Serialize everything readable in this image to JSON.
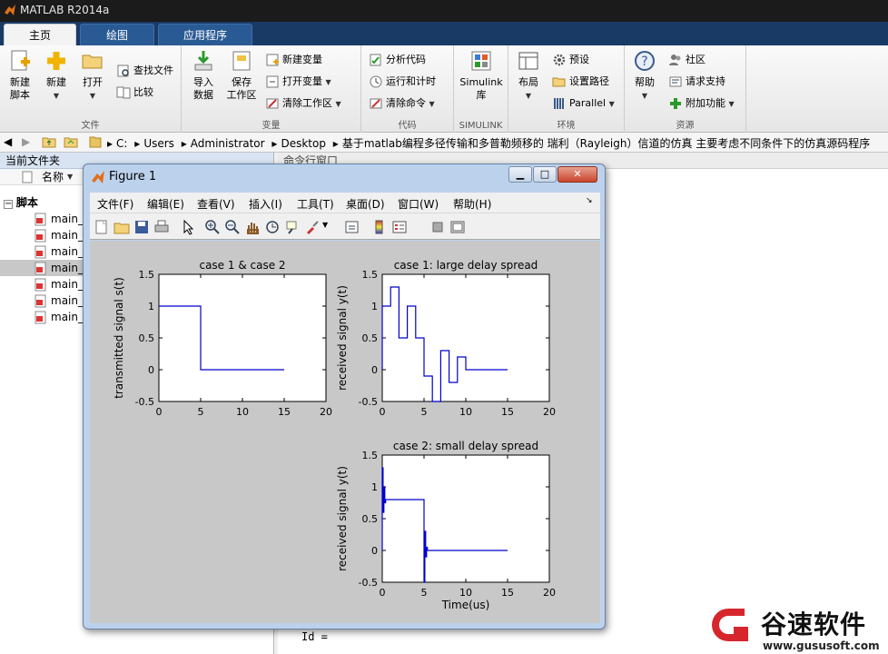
{
  "app": {
    "title": "MATLAB R2014a"
  },
  "tabs": [
    "主页",
    "绘图",
    "应用程序"
  ],
  "ribbon": {
    "file": {
      "label": "文件",
      "new_script": "新建\n脚本",
      "new": "新建",
      "open": "打开",
      "find_files": "查找文件",
      "compare": "比较"
    },
    "variable": {
      "label": "变量",
      "import": "导入\n数据",
      "save_ws": "保存\n工作区",
      "new_var": "新建变量",
      "open_var": "打开变量",
      "clear_ws": "清除工作区"
    },
    "code": {
      "label": "代码",
      "analyze": "分析代码",
      "run_time": "运行和计时",
      "clear_cmd": "清除命令"
    },
    "simulink": {
      "label": "SIMULINK",
      "lib": "Simulink\n库"
    },
    "env": {
      "label": "环境",
      "layout": "布局",
      "prefs": "预设",
      "set_path": "设置路径",
      "parallel": "Parallel"
    },
    "resources": {
      "label": "资源",
      "help": "帮助",
      "community": "社区",
      "support": "请求支持",
      "addons": "附加功能"
    }
  },
  "address": {
    "segments": [
      "C:",
      "Users",
      "Administrator",
      "Desktop",
      "基于matlab编程多径传输和多普勒频移的 瑞利（Rayleigh）信道的仿真 主要考虑不同条件下的仿真源码程序"
    ]
  },
  "current_folder": {
    "title": "当前文件夹",
    "col_name": "名称",
    "group": "脚本",
    "files": [
      "main_",
      "main_",
      "main_",
      "main_",
      "main_",
      "main_",
      "main_"
    ],
    "selected_index": 3
  },
  "command_window": {
    "title": "命令行窗口",
    "prompt_text": "Id ="
  },
  "figure": {
    "caption": "Figure 1",
    "menu": [
      "文件(F)",
      "编辑(E)",
      "查看(V)",
      "插入(I)",
      "工具(T)",
      "桌面(D)",
      "窗口(W)",
      "帮助(H)"
    ]
  },
  "chart_data": [
    {
      "type": "line",
      "title": "case 1 & case 2",
      "xlabel": "",
      "ylabel": "transmitted signal s(t)",
      "xlim": [
        0,
        20
      ],
      "ylim": [
        -0.5,
        1.5
      ],
      "xticks": [
        0,
        5,
        10,
        15,
        20
      ],
      "yticks": [
        -0.5,
        0,
        0.5,
        1,
        1.5
      ],
      "series": [
        {
          "color": "#0000cc",
          "x": [
            0,
            5,
            5,
            15
          ],
          "y": [
            1,
            1,
            0,
            0
          ]
        }
      ]
    },
    {
      "type": "line",
      "title": "case 1: large delay spread",
      "xlabel": "",
      "ylabel": "received signal y(t)",
      "xlim": [
        0,
        20
      ],
      "ylim": [
        -0.5,
        1.5
      ],
      "xticks": [
        0,
        5,
        10,
        15,
        20
      ],
      "yticks": [
        -0.5,
        0,
        0.5,
        1,
        1.5
      ],
      "series": [
        {
          "color": "#0000cc",
          "x": [
            0,
            0,
            1,
            1,
            2,
            2,
            3,
            3,
            4,
            4,
            5,
            5,
            6,
            6,
            7,
            7,
            8,
            8,
            9,
            9,
            10,
            10,
            15
          ],
          "y": [
            0,
            1,
            1,
            1.3,
            1.3,
            0.5,
            0.5,
            1,
            1,
            0.5,
            0.5,
            -0.1,
            -0.1,
            -0.5,
            -0.5,
            0.3,
            0.3,
            -0.2,
            -0.2,
            0.2,
            0.2,
            0,
            0
          ]
        }
      ]
    },
    {
      "type": "line",
      "title": "case 2: small delay spread",
      "xlabel": "Time(us)",
      "ylabel": "received signal y(t)",
      "xlim": [
        0,
        20
      ],
      "ylim": [
        -0.5,
        1.5
      ],
      "xticks": [
        0,
        5,
        10,
        15,
        20
      ],
      "yticks": [
        -0.5,
        0,
        0.5,
        1,
        1.5
      ],
      "series": [
        {
          "color": "#0000cc",
          "x": [
            0,
            0,
            0.1,
            0.1,
            0.2,
            0.2,
            0.3,
            0.3,
            0.4,
            0.4,
            5,
            5,
            5.1,
            5.1,
            5.2,
            5.2,
            5.3,
            5.3,
            5.4,
            5.4,
            15
          ],
          "y": [
            0,
            1.3,
            1.3,
            0.6,
            0.6,
            1.0,
            1.0,
            0.75,
            0.75,
            0.8,
            0.8,
            -0.5,
            -0.5,
            0.3,
            0.3,
            -0.1,
            -0.1,
            0.05,
            0.05,
            0,
            0
          ]
        }
      ]
    }
  ],
  "watermark": {
    "brand": "谷速软件",
    "url": "www.gususoft.com"
  }
}
